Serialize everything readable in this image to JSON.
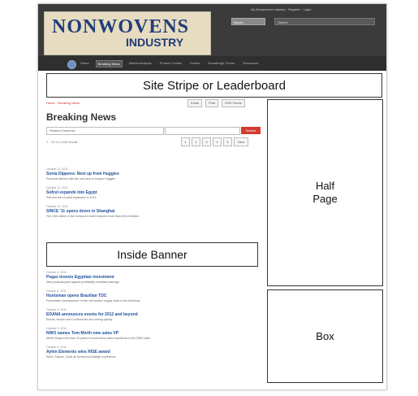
{
  "header": {
    "logo_main": "NONWOVENS",
    "logo_sub": "INDUSTRY",
    "top_links": "My Nonwovens Industry · Register · Login",
    "issue_label": "Issues",
    "search_placeholder": "Search"
  },
  "nav": {
    "items": [
      "Home",
      "Breaking News",
      "Market Analysis",
      "Product Guides",
      "Events",
      "Knowledge Center",
      "Resources"
    ]
  },
  "ads": {
    "leaderboard": "Site Stripe or Leaderboard",
    "half_line1": "Half",
    "half_line2": "Page",
    "box": "Box",
    "inside": "Inside Banner"
  },
  "content": {
    "breadcrumb": "Home · Breaking News",
    "tools": [
      "Email",
      "Print",
      "RSS Feeds"
    ],
    "title": "Breaking News",
    "filter_placeholder": "Related Searches",
    "search_placeholder": "",
    "go_label": "Search",
    "results_count": "1 - 10 of 1,058 results",
    "pages": [
      "1",
      "2",
      "3",
      "4",
      "5"
    ],
    "next_label": "Next",
    "articles": [
      {
        "date": "October 12, 2011",
        "title": "Sonia Dippens: Next up from Huggies",
        "desc": "Personal delivery with the next door to today's Huggies"
      },
      {
        "date": "October 12, 2011",
        "title": "Sofcel expands into Egypt",
        "desc": "Soft and line of plant expansion in 2013"
      },
      {
        "date": "October 12, 2011",
        "title": "SINCE '11 opens doors in Shanghai",
        "desc": "The 14th edition of the nonwoven event features more than 400 exhibitors"
      },
      {
        "date": "October 6, 2011",
        "title": "Pegas invests Egyptian investment",
        "desc": "New products plant against profitability-motivated damage"
      },
      {
        "date": "October 6, 2011",
        "title": "Huntsman opens Brazilian TDC",
        "desc": "Formulation Development Center will shorten supply chain to the Americas"
      },
      {
        "date": "October 5, 2011",
        "title": "EDANA announces events for 2012 and beyond",
        "desc": "Shows, houses and Conferences are coming quickly"
      },
      {
        "date": "October 5, 2011",
        "title": "NWO names Tom Merth new sales VP",
        "desc": "Merth brings more than 20 years of nonwovens sales experience to the NWO team"
      },
      {
        "date": "October 5, 2011",
        "title": "Ayhin Elements wins RISE award",
        "desc": "INDA, Fabrics, Cullis all honored at Raleigh conference"
      }
    ]
  }
}
